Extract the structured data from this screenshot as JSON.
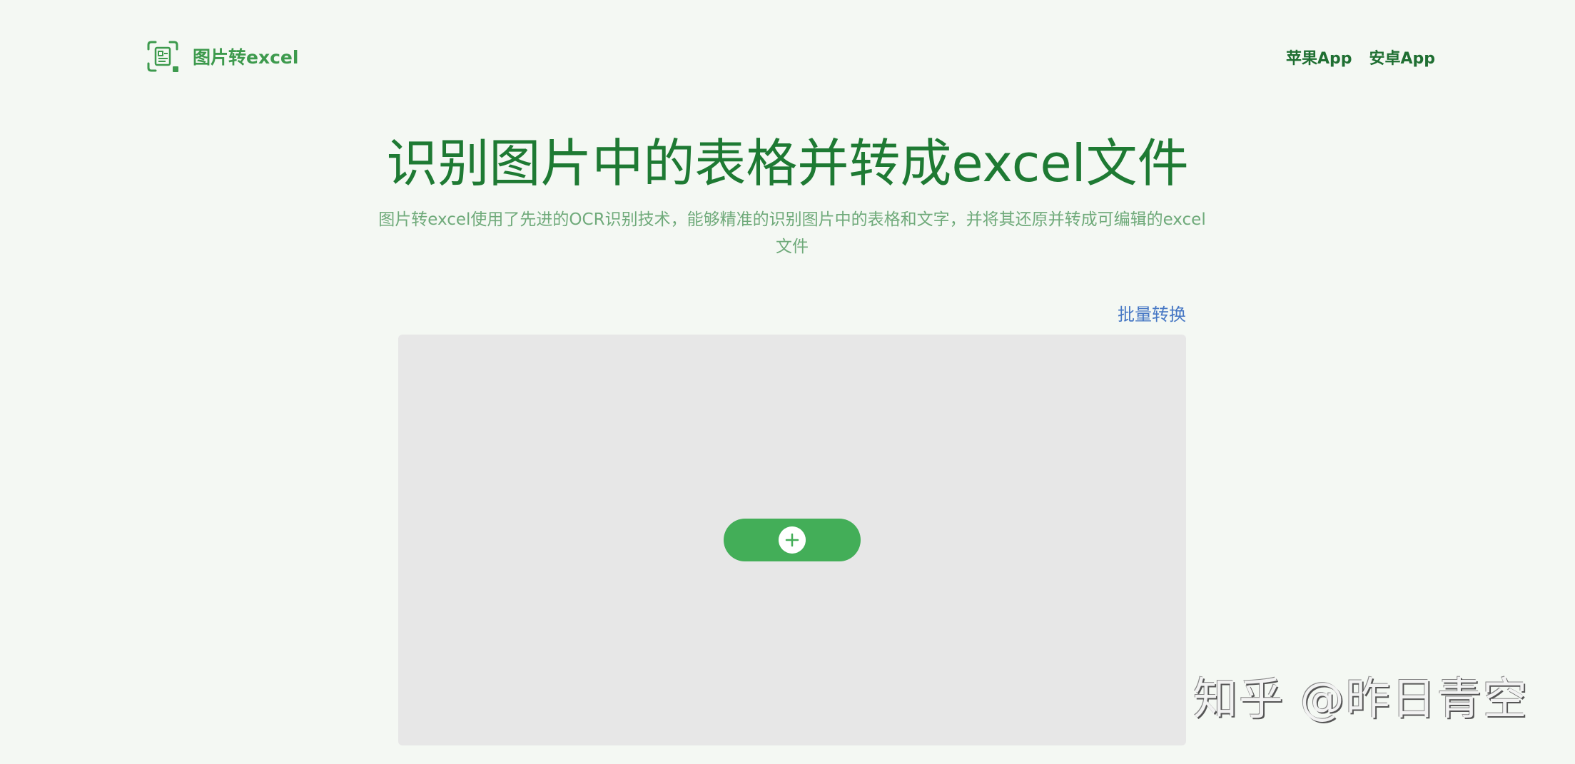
{
  "header": {
    "logo_text": "图片转excel",
    "logo_icon": "scan-document-icon",
    "nav": [
      {
        "label": "苹果App"
      },
      {
        "label": "安卓App"
      }
    ]
  },
  "hero": {
    "title": "识别图片中的表格并转成excel文件",
    "subtitle": "图片转excel使用了先进的OCR识别技术，能够精准的识别图片中的表格和文字，并将其还原并转成可编辑的excel文件"
  },
  "upload": {
    "batch_label": "批量转换",
    "button_icon": "plus-circle-icon"
  },
  "watermark": {
    "text": "知乎 @昨日青空"
  },
  "colors": {
    "brand_green": "#43ae58",
    "title_green": "#1e7a33",
    "link_blue": "#4677c4",
    "upload_bg": "#e7e7e7",
    "page_bg": "#f4f8f3"
  }
}
